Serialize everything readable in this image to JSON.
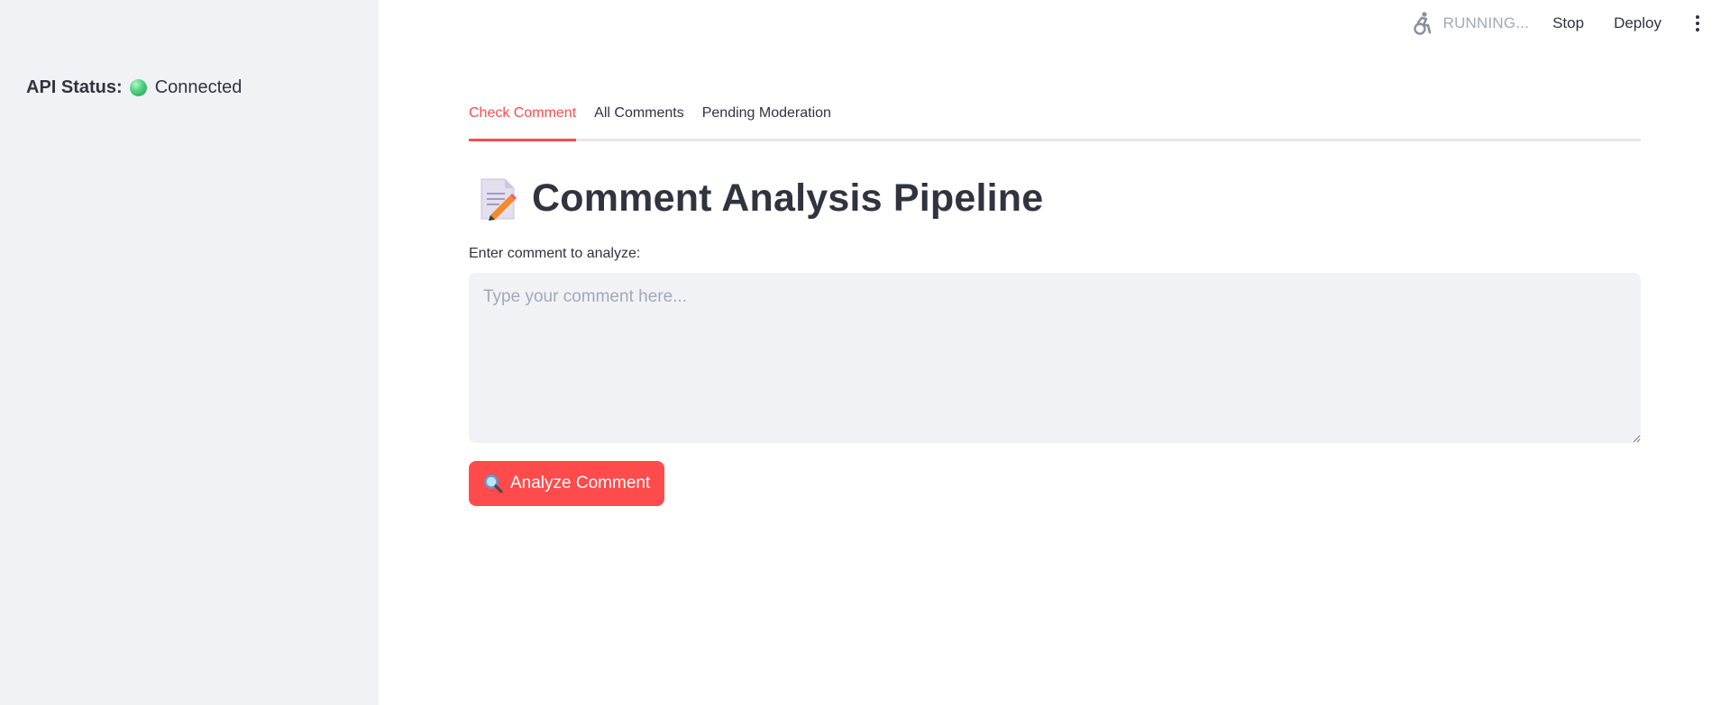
{
  "sidebar": {
    "api_status_label": "API Status:",
    "api_status_value": "Connected",
    "status_color": "#2ecc71"
  },
  "toolbar": {
    "running_icon": "running-person-icon",
    "running_text": "RUNNING...",
    "stop_label": "Stop",
    "deploy_label": "Deploy",
    "menu_icon": "vertical-dots-icon"
  },
  "tabs": [
    {
      "label": "Check Comment",
      "active": true
    },
    {
      "label": "All Comments",
      "active": false
    },
    {
      "label": "Pending Moderation",
      "active": false
    }
  ],
  "main": {
    "title_icon": "memo-icon",
    "title": "Comment Analysis Pipeline",
    "comment_label": "Enter comment to analyze:",
    "comment_placeholder": "Type your comment here...",
    "comment_value": "",
    "analyze_icon": "magnifying-glass-icon",
    "analyze_label": "Analyze Comment"
  },
  "colors": {
    "accent": "#ff4b4b",
    "sidebar_bg": "#f0f2f6",
    "text": "#31333f",
    "muted": "#a3a8b8"
  }
}
